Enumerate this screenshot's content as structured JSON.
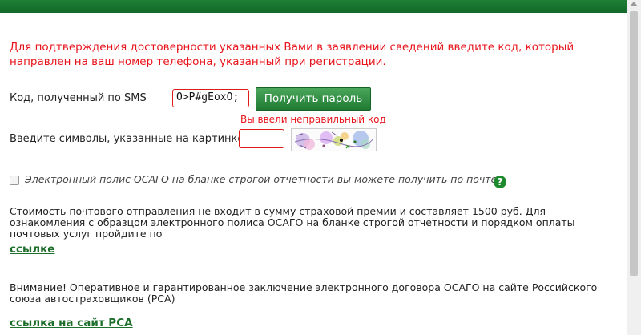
{
  "notice": "Для подтверждения достоверности указанных Вами в заявлении сведений введите код, который направлен на ваш номер телефона, указанный при регистрации.",
  "sms": {
    "label": "Код, полученный по SMS",
    "value": "O>P#gEoxO;",
    "button_label": "Получить пароль",
    "error": "Вы ввели неправильный код"
  },
  "captcha": {
    "label": "Введите символы, указанные на картинке:",
    "value": ""
  },
  "postal": {
    "checked": false,
    "label": "Электронный полис ОСАГО на бланке строгой отчетности вы можете получить по почте.",
    "help_icon": "question-icon",
    "info": "Стоимость почтового отправления не входит в сумму страховой премии и составляет 1500 руб. Для ознакомления с образцом электронного полиса ОСАГО на бланке строгой отчетности и порядком оплаты почтовых услуг пройдите по",
    "link_label": "ссылке"
  },
  "attention": {
    "text": "Внимание! Оперативное и гарантированное заключение электронного договора ОСАГО на сайте Российского союза автостраховщиков (РСА)",
    "link_label": "ссылка на сайт РСА"
  },
  "colors": {
    "accent_green": "#1e7f34",
    "error_red": "#e8141c",
    "link_green": "#1f6f2c"
  }
}
